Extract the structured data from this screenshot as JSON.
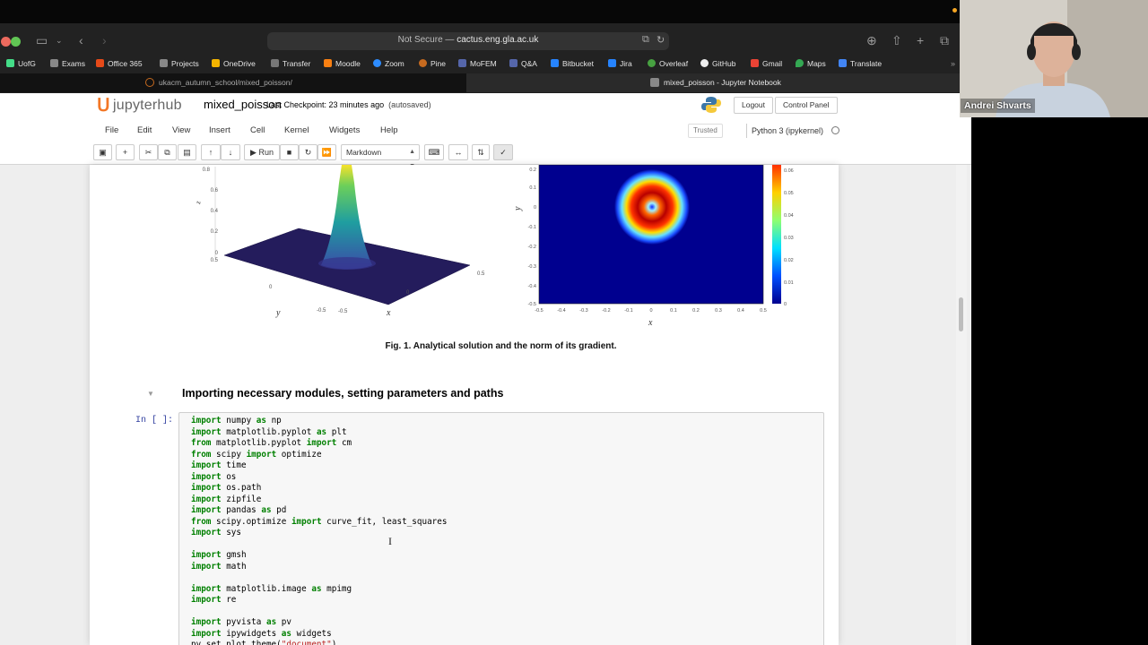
{
  "browser": {
    "url_prefix": "Not Secure —",
    "url_host": "cactus.eng.gla.ac.uk",
    "favorites": [
      "UofG",
      "Exams",
      "Office 365",
      "Projects",
      "OneDrive",
      "Transfer",
      "Moodle",
      "Zoom",
      "Pine",
      "MoFEM",
      "Q&A",
      "Bitbucket",
      "Jira",
      "Overleaf",
      "GitHub",
      "Gmail",
      "Maps",
      "Translate"
    ],
    "tabs": [
      {
        "title": "ukacm_autumn_school/mixed_poisson/",
        "active": false
      },
      {
        "title": "mixed_poisson - Jupyter Notebook",
        "active": true
      }
    ]
  },
  "jupyter": {
    "logo_text": "jupyterhub",
    "notebook_name": "mixed_poisson",
    "checkpoint": "Last Checkpoint: 23 minutes ago",
    "autosaved": "(autosaved)",
    "logout": "Logout",
    "control_panel": "Control Panel",
    "menu": [
      "File",
      "Edit",
      "View",
      "Insert",
      "Cell",
      "Kernel",
      "Widgets",
      "Help"
    ],
    "trusted": "Trusted",
    "kernel": "Python 3 (ipykernel)",
    "run_label": "Run",
    "cell_type": "Markdown"
  },
  "notebook": {
    "figure": {
      "left_plot": {
        "z_ticks": [
          "0.8",
          "0.6",
          "0.4",
          "0.2",
          "0",
          "0.5"
        ],
        "z_label": "z",
        "x_ticks": [
          "-0.5",
          "0",
          "0.5"
        ],
        "y_ticks": [
          "-0.5",
          "0"
        ],
        "x_label": "x",
        "y_label": "y"
      },
      "right_plot": {
        "y_ticks": [
          "0.2",
          "0.1",
          "0",
          "-0.1",
          "-0.2",
          "-0.3",
          "-0.4",
          "-0.5"
        ],
        "x_ticks": [
          "-0.5",
          "-0.4",
          "-0.3",
          "-0.2",
          "-0.1",
          "0",
          "0.1",
          "0.2",
          "0.3",
          "0.4",
          "0.5"
        ],
        "x_label": "x",
        "y_label": "y",
        "colorbar_ticks": [
          "0.06",
          "0.05",
          "0.04",
          "0.03",
          "0.02",
          "0.01",
          "0"
        ]
      },
      "caption": "Fig. 1. Analytical solution and the norm of its gradient."
    },
    "heading": "Importing necessary modules, setting parameters and paths",
    "prompt": "In [ ]:",
    "code_lines": [
      [
        [
          "kw",
          "import"
        ],
        [
          "t",
          " numpy "
        ],
        [
          "kw",
          "as"
        ],
        [
          "t",
          " np"
        ]
      ],
      [
        [
          "kw",
          "import"
        ],
        [
          "t",
          " matplotlib.pyplot "
        ],
        [
          "kw",
          "as"
        ],
        [
          "t",
          " plt"
        ]
      ],
      [
        [
          "kw",
          "from"
        ],
        [
          "t",
          " matplotlib.pyplot "
        ],
        [
          "kw",
          "import"
        ],
        [
          "t",
          " cm"
        ]
      ],
      [
        [
          "kw",
          "from"
        ],
        [
          "t",
          " scipy "
        ],
        [
          "kw",
          "import"
        ],
        [
          "t",
          " optimize"
        ]
      ],
      [
        [
          "kw",
          "import"
        ],
        [
          "t",
          " time"
        ]
      ],
      [
        [
          "kw",
          "import"
        ],
        [
          "t",
          " os"
        ]
      ],
      [
        [
          "kw",
          "import"
        ],
        [
          "t",
          " os.path"
        ]
      ],
      [
        [
          "kw",
          "import"
        ],
        [
          "t",
          " zipfile"
        ]
      ],
      [
        [
          "kw",
          "import"
        ],
        [
          "t",
          " pandas "
        ],
        [
          "kw",
          "as"
        ],
        [
          "t",
          " pd"
        ]
      ],
      [
        [
          "kw",
          "from"
        ],
        [
          "t",
          " scipy.optimize "
        ],
        [
          "kw",
          "import"
        ],
        [
          "t",
          " curve_fit, least_squares"
        ]
      ],
      [
        [
          "kw",
          "import"
        ],
        [
          "t",
          " sys"
        ]
      ],
      [
        [
          "t",
          ""
        ]
      ],
      [
        [
          "kw",
          "import"
        ],
        [
          "t",
          " gmsh"
        ]
      ],
      [
        [
          "kw",
          "import"
        ],
        [
          "t",
          " math"
        ]
      ],
      [
        [
          "t",
          ""
        ]
      ],
      [
        [
          "kw",
          "import"
        ],
        [
          "t",
          " matplotlib.image "
        ],
        [
          "kw",
          "as"
        ],
        [
          "t",
          " mpimg"
        ]
      ],
      [
        [
          "kw",
          "import"
        ],
        [
          "t",
          " re"
        ]
      ],
      [
        [
          "t",
          ""
        ]
      ],
      [
        [
          "kw",
          "import"
        ],
        [
          "t",
          " pyvista "
        ],
        [
          "kw",
          "as"
        ],
        [
          "t",
          " pv"
        ]
      ],
      [
        [
          "kw",
          "import"
        ],
        [
          "t",
          " ipywidgets "
        ],
        [
          "kw",
          "as"
        ],
        [
          "t",
          " widgets"
        ]
      ],
      [
        [
          "t",
          "pv.set_plot_theme("
        ],
        [
          "str",
          "\"document\""
        ],
        [
          "t",
          ")"
        ]
      ]
    ]
  },
  "webcam": {
    "name": "Andrei Shvarts"
  }
}
